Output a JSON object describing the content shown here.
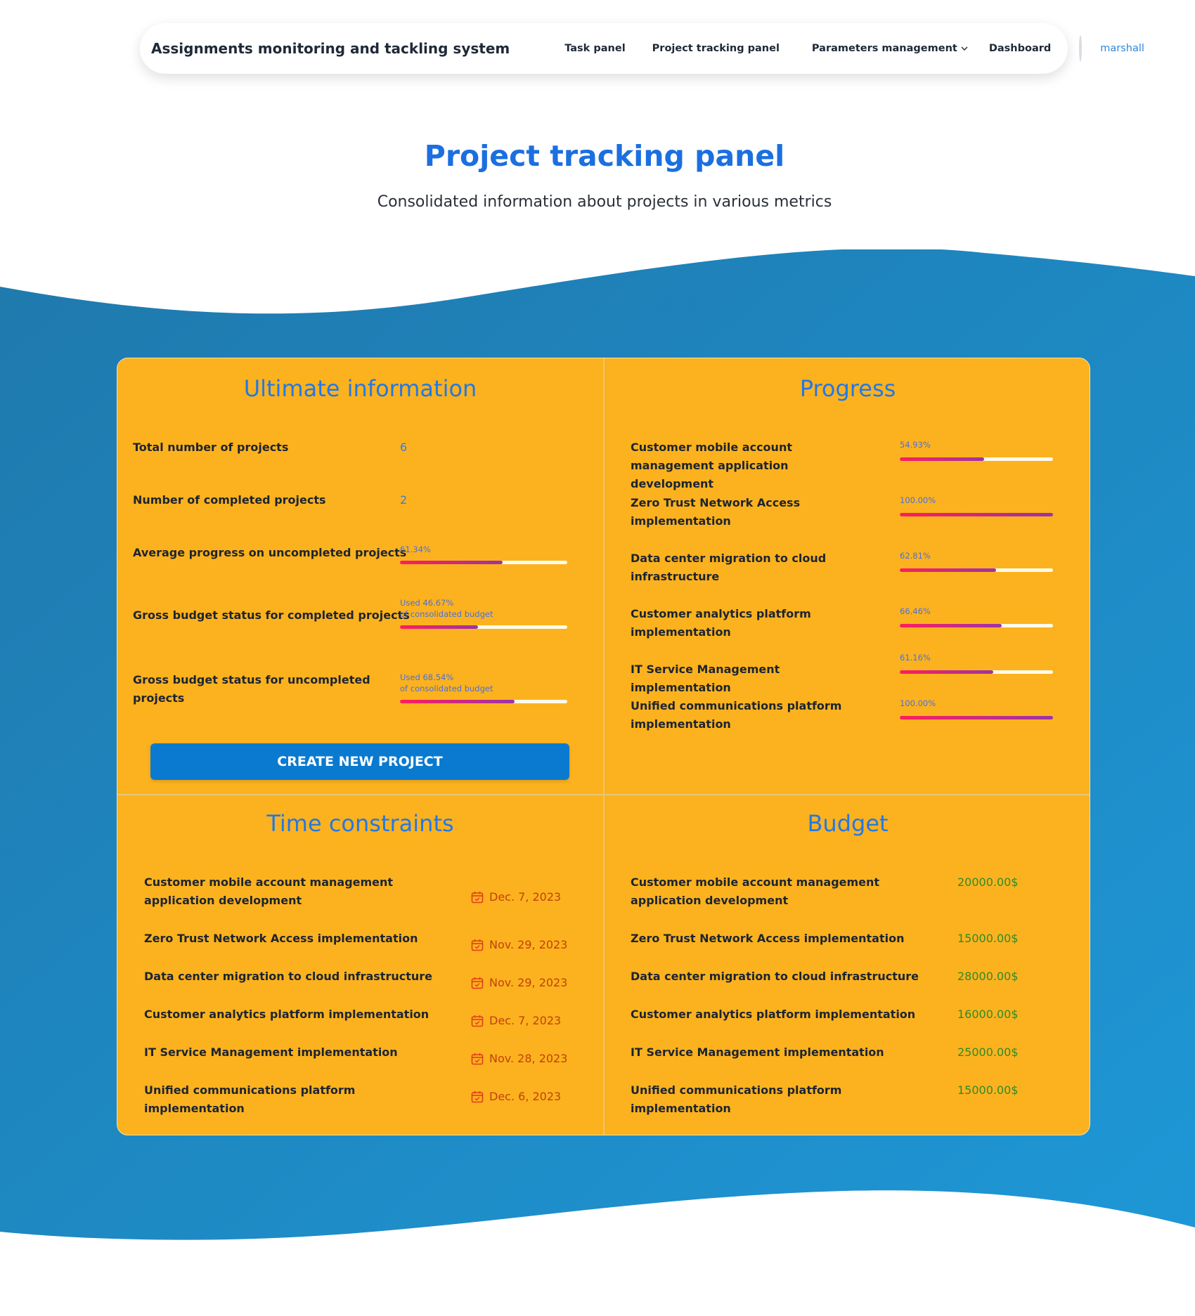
{
  "nav": {
    "brand": "Assignments monitoring and tackling system",
    "links": [
      "Task panel",
      "Project tracking panel",
      "Parameters management",
      "Dashboard"
    ],
    "username": "marshall"
  },
  "header": {
    "title": "Project tracking panel",
    "subtitle": "Consolidated information about projects in various metrics"
  },
  "ultimate": {
    "title": "Ultimate information",
    "total_label": "Total number of projects",
    "total_value": "6",
    "completed_label": "Number of completed projects",
    "completed_value": "2",
    "avg_label": "Average progress on uncompleted projects",
    "avg_value": "61.34%",
    "avg_fraction": 0.6134,
    "gross_completed_label": "Gross budget status for completed projects",
    "gross_completed_line1": "Used 46.67%",
    "gross_completed_line2": "of consolidated budget",
    "gross_completed_fraction": 0.4667,
    "gross_uncompleted_label": "Gross budget status for uncompleted projects",
    "gross_uncompleted_line1": "Used 68.54%",
    "gross_uncompleted_line2": "of consolidated budget",
    "gross_uncompleted_fraction": 0.6854,
    "create_button": "CREATE NEW PROJECT"
  },
  "progress": {
    "title": "Progress",
    "items": [
      {
        "name": "Customer mobile account management application development",
        "percent": "54.93%",
        "fraction": 0.5493
      },
      {
        "name": "Zero Trust Network Access implementation",
        "percent": "100.00%",
        "fraction": 1.0
      },
      {
        "name": "Data center migration to cloud infrastructure",
        "percent": "62.81%",
        "fraction": 0.6281
      },
      {
        "name": "Customer analytics platform implementation",
        "percent": "66.46%",
        "fraction": 0.6646
      },
      {
        "name": "IT Service Management implementation",
        "percent": "61.16%",
        "fraction": 0.6116
      },
      {
        "name": "Unified communications platform implementation",
        "percent": "100.00%",
        "fraction": 1.0
      }
    ]
  },
  "time": {
    "title": "Time constraints",
    "items": [
      {
        "name": "Customer mobile account management application development",
        "date": "Dec. 7, 2023"
      },
      {
        "name": "Zero Trust Network Access implementation",
        "date": "Nov. 29, 2023"
      },
      {
        "name": "Data center migration to cloud infrastructure",
        "date": "Nov. 29, 2023"
      },
      {
        "name": "Customer analytics platform implementation",
        "date": "Dec. 7, 2023"
      },
      {
        "name": "IT Service Management implementation",
        "date": "Nov. 28, 2023"
      },
      {
        "name": "Unified communications platform implementation",
        "date": "Dec. 6, 2023"
      }
    ]
  },
  "budget": {
    "title": "Budget",
    "items": [
      {
        "name": "Customer mobile account management application development",
        "amount": "20000.00$"
      },
      {
        "name": "Zero Trust Network Access implementation",
        "amount": "15000.00$"
      },
      {
        "name": "Data center migration to cloud infrastructure",
        "amount": "28000.00$"
      },
      {
        "name": "Customer analytics platform implementation",
        "amount": "16000.00$"
      },
      {
        "name": "IT Service Management implementation",
        "amount": "25000.00$"
      },
      {
        "name": "Unified communications platform implementation",
        "amount": "15000.00$"
      }
    ]
  },
  "colors": {
    "card": "#fcb21e",
    "accent_blue": "#1b6fe0",
    "button": "#0a7ad0",
    "bar_start": "#ff1d5c",
    "bar_end": "#9c33a9",
    "date": "#c2410c",
    "money": "#2e8b28"
  }
}
